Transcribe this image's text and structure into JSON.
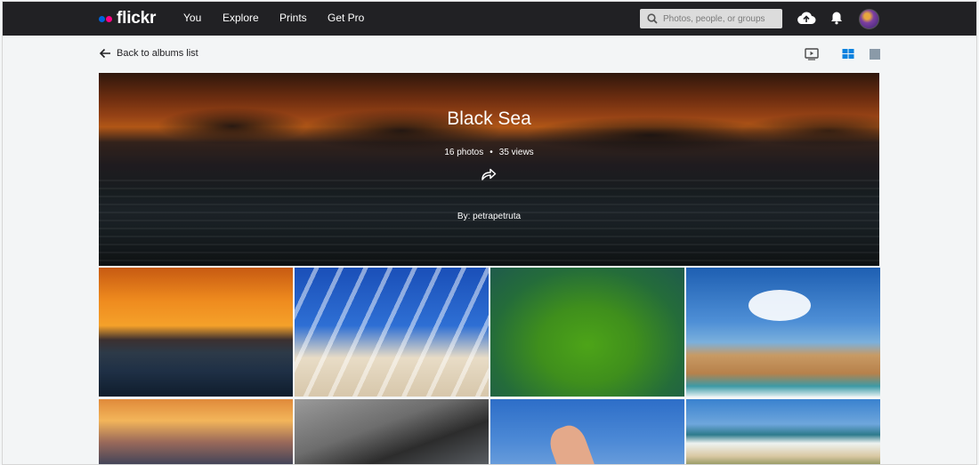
{
  "topbar": {
    "logo_text": "flickr",
    "nav": [
      "You",
      "Explore",
      "Prints",
      "Get Pro"
    ],
    "search_placeholder": "Photos, people, or groups",
    "icons": [
      "upload-cloud-icon",
      "bell-icon",
      "avatar"
    ]
  },
  "subbar": {
    "back_label": "Back to albums list",
    "view_icons": [
      "slideshow-icon",
      "grid-view-icon",
      "single-view-icon"
    ]
  },
  "album": {
    "title": "Black Sea",
    "photos_count": "16 photos",
    "views_count": "35 views",
    "separator": "•",
    "by": "By: petrapetruta"
  },
  "photos": [
    {
      "name": "photo-sunset-sea"
    },
    {
      "name": "photo-beach-pergola"
    },
    {
      "name": "photo-green-water"
    },
    {
      "name": "photo-sandy-beach"
    },
    {
      "name": "photo-sunset-waves"
    },
    {
      "name": "photo-wet-sand"
    },
    {
      "name": "photo-hand-sky"
    },
    {
      "name": "photo-dunes-sea"
    }
  ],
  "colors": {
    "topbar_bg": "#212124",
    "accent_blue": "#0063dc",
    "accent_pink": "#ff0084",
    "active_view": "#0a82df"
  }
}
